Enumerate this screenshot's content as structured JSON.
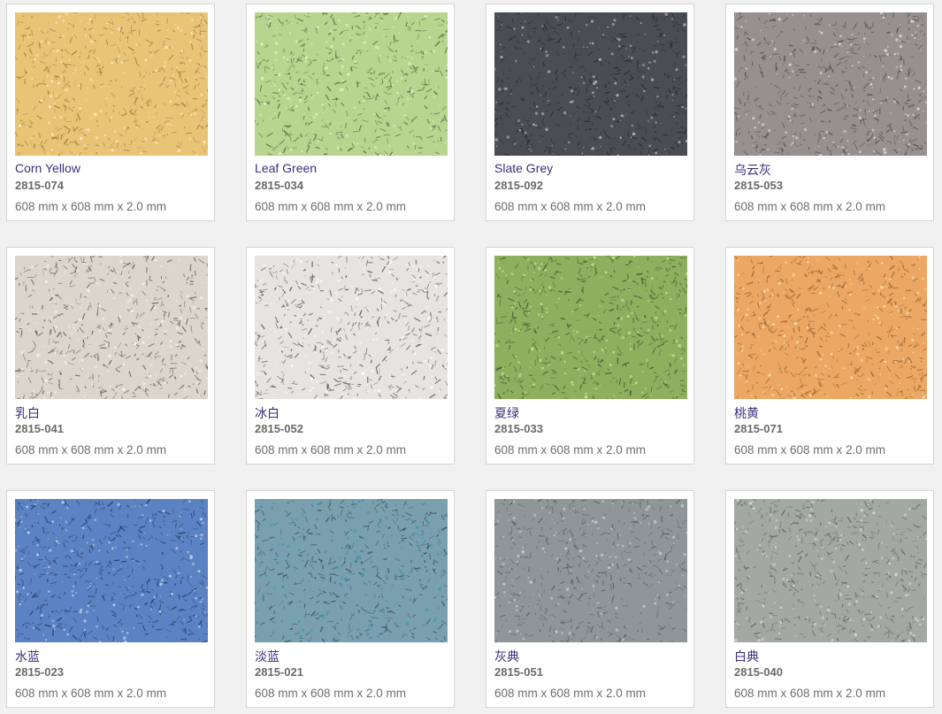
{
  "products": [
    {
      "name": "Corn Yellow",
      "code": "2815-074",
      "dims": "608 mm x 608 mm x 2.0 mm",
      "colors": [
        "#e9c477",
        "#9a7a3a",
        "#f8e9bd"
      ]
    },
    {
      "name": "Leaf Green",
      "code": "2815-034",
      "dims": "608 mm x 608 mm x 2.0 mm",
      "colors": [
        "#b7d58f",
        "#4e6440",
        "#e3f0c6"
      ]
    },
    {
      "name": "Slate Grey",
      "code": "2815-092",
      "dims": "608 mm x 608 mm x 2.0 mm",
      "colors": [
        "#4a4e53",
        "#26292d",
        "#a6aaae"
      ]
    },
    {
      "name": "乌云灰",
      "code": "2815-053",
      "dims": "608 mm x 608 mm x 2.0 mm",
      "colors": [
        "#96918f",
        "#4d4a48",
        "#d8d4d1"
      ]
    },
    {
      "name": "乳白",
      "code": "2815-041",
      "dims": "608 mm x 608 mm x 2.0 mm",
      "colors": [
        "#dcd5cb",
        "#5b554f",
        "#f5f1ea"
      ]
    },
    {
      "name": "冰白",
      "code": "2815-052",
      "dims": "608 mm x 608 mm x 2.0 mm",
      "colors": [
        "#e6e4e2",
        "#4f4f52",
        "#fbfbfb"
      ]
    },
    {
      "name": "夏绿",
      "code": "2815-033",
      "dims": "608 mm x 608 mm x 2.0 mm",
      "colors": [
        "#8eaf5d",
        "#3f5233",
        "#c9dd8f"
      ]
    },
    {
      "name": "桃黄",
      "code": "2815-071",
      "dims": "608 mm x 608 mm x 2.0 mm",
      "colors": [
        "#eba763",
        "#8e5c2f",
        "#f9d9ad"
      ]
    },
    {
      "name": "水蓝",
      "code": "2815-023",
      "dims": "608 mm x 608 mm x 2.0 mm",
      "colors": [
        "#5b82c2",
        "#23365e",
        "#b9cde9"
      ]
    },
    {
      "name": "淡蓝",
      "code": "2815-021",
      "dims": "608 mm x 608 mm x 2.0 mm",
      "colors": [
        "#7a9fae",
        "#2f4c57",
        "#3e9cb0"
      ]
    },
    {
      "name": "灰典",
      "code": "2815-051",
      "dims": "608 mm x 608 mm x 2.0 mm",
      "colors": [
        "#8f9697",
        "#555d5e",
        "#c2c8c8"
      ]
    },
    {
      "name": "白典",
      "code": "2815-040",
      "dims": "608 mm x 608 mm x 2.0 mm",
      "colors": [
        "#a2a8a3",
        "#5e6460",
        "#d2d6d2"
      ]
    }
  ]
}
